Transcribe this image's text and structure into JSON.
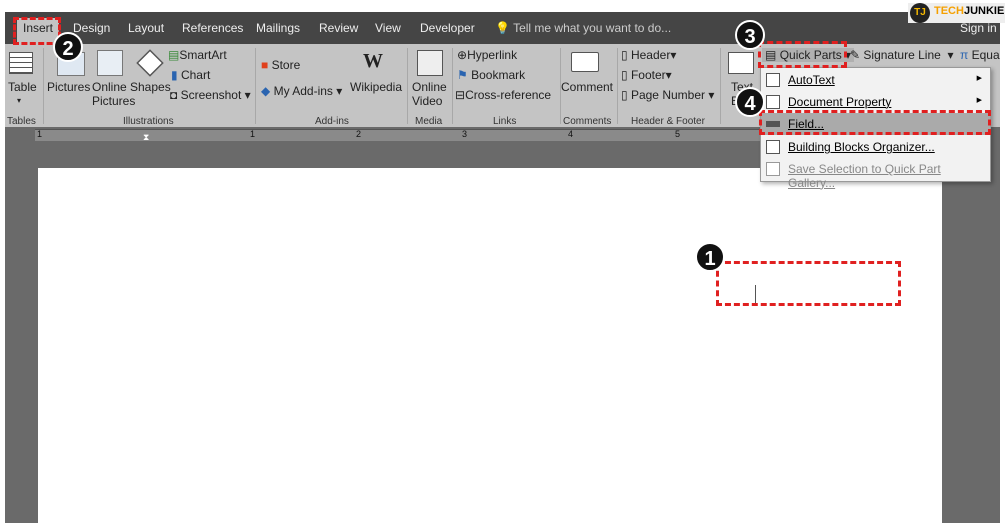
{
  "brand": {
    "logo": "TJ",
    "name_a": "TECH",
    "name_b": "JUNKIE"
  },
  "tabs": [
    "Insert",
    "Design",
    "Layout",
    "References",
    "Mailings",
    "Review",
    "View",
    "Developer"
  ],
  "tell_me": "Tell me what you want to do...",
  "sign_in": "Sign in",
  "ribbon": {
    "table": "Table",
    "pictures": "Pictures",
    "online_pictures_1": "Online",
    "online_pictures_2": "Pictures",
    "shapes": "Shapes",
    "smartart": "SmartArt",
    "chart": "Chart",
    "screenshot": "Screenshot",
    "store": "Store",
    "my_addins": "My Add-ins",
    "wikipedia": "Wikipedia",
    "online_video_1": "Online",
    "online_video_2": "Video",
    "hyperlink": "Hyperlink",
    "bookmark": "Bookmark",
    "cross_reference": "Cross-reference",
    "comment": "Comment",
    "header": "Header",
    "footer": "Footer",
    "page_number": "Page Number",
    "text_box_1": "Text",
    "text_box_2": "B",
    "quick_parts": "Quick Parts",
    "signature_line": "Signature Line",
    "equation": "Equa",
    "groups": {
      "tables": "Tables",
      "illustrations": "Illustrations",
      "addins": "Add-ins",
      "media": "Media",
      "links": "Links",
      "comments": "Comments",
      "header_footer": "Header & Footer"
    }
  },
  "ruler": [
    "1",
    "1",
    "2",
    "3",
    "4",
    "5"
  ],
  "quick_parts_menu": [
    {
      "label": "AutoText",
      "submenu": true
    },
    {
      "label": "Document Property",
      "submenu": true
    },
    {
      "label": "Field...",
      "submenu": false,
      "highlighted": true
    },
    {
      "label": "Building Blocks Organizer...",
      "submenu": false
    },
    {
      "label": "Save Selection to Quick Part Gallery...",
      "submenu": false,
      "disabled": true
    }
  ],
  "steps": [
    "1",
    "2",
    "3",
    "4"
  ],
  "colors": {
    "annotation": "#e02020",
    "tabbar": "#454545",
    "ribbon": "#c4c4c4"
  }
}
